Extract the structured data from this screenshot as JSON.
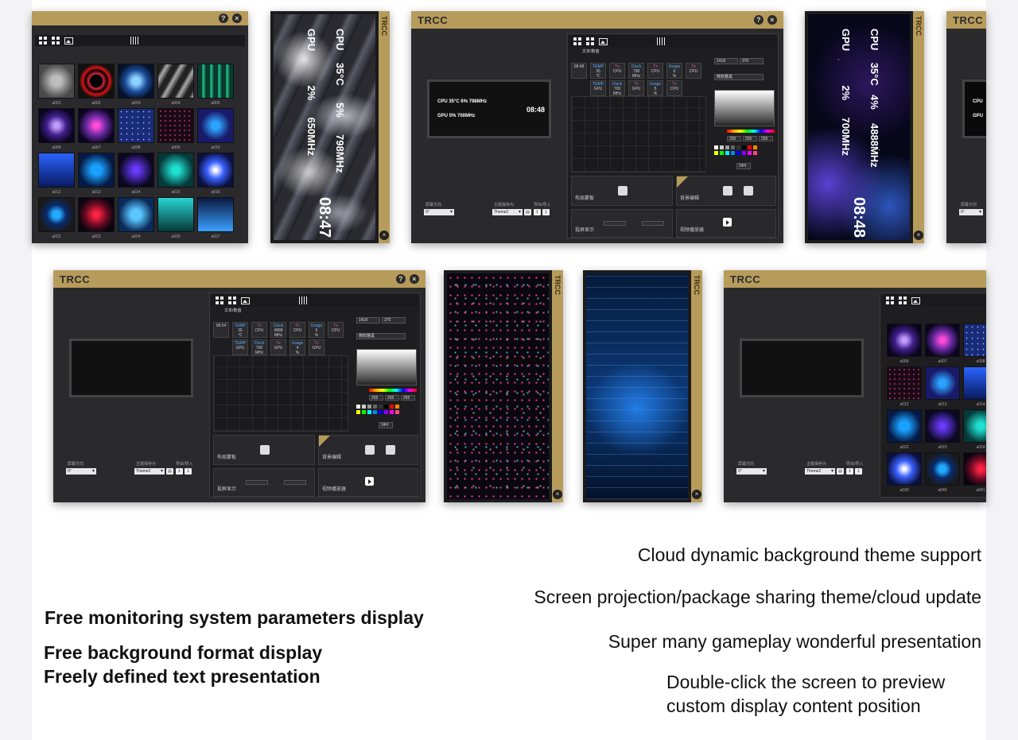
{
  "app": {
    "title": "TRCC",
    "help_icon": "question-icon",
    "close_icon": "close-icon"
  },
  "preview_silk": {
    "cpu_label": "CPU",
    "cpu_temp": "35°C",
    "cpu_usage": "5%",
    "cpu_clock": "798MHz",
    "gpu_label": "GPU",
    "gpu_usage": "2%",
    "gpu_clock": "650MHz",
    "time": "08:47"
  },
  "preview_space": {
    "cpu_label": "CPU",
    "cpu_temp": "35°C",
    "cpu_usage": "4%",
    "cpu_clock": "4888MHz",
    "gpu_label": "GPU",
    "gpu_usage": "2%",
    "gpu_clock": "700MHz",
    "time": "08:48"
  },
  "editor_preview": {
    "cpu_line": "CPU 35°C   6%   798MHz",
    "gpu_line": "GPU         5%   700MHz",
    "time": "08:48"
  },
  "editor": {
    "text_image_tab": "文本/数值",
    "cells_row1": [
      {
        "top": "TEMP",
        "mid": "35",
        "bot": "℃"
      },
      {
        "top": "Tx",
        "mid": "CPU",
        "bot": ""
      },
      {
        "top": "Clock",
        "mid": "798",
        "bot": "MHz"
      },
      {
        "top": "Tx",
        "mid": "CPU",
        "bot": ""
      },
      {
        "top": "Usage",
        "mid": "6",
        "bot": "%"
      },
      {
        "top": "Tx",
        "mid": "CPU",
        "bot": ""
      }
    ],
    "cells_row2": [
      {
        "top": "TEMP",
        "mid": "GPU",
        "bot": ""
      },
      {
        "top": "Clock",
        "mid": "700",
        "bot": "MHz"
      },
      {
        "top": "Tx",
        "mid": "GPU",
        "bot": ""
      },
      {
        "top": "Usage",
        "mid": "5",
        "bot": "%"
      },
      {
        "top": "Tx",
        "mid": "CPU",
        "bot": ""
      }
    ],
    "time_cell": "08:48",
    "coord_x": "1418",
    "coord_y": "370",
    "font_value": "微软雅黑",
    "font_size": "22",
    "rgb": [
      "255",
      "255",
      "255"
    ],
    "hour_format": "24H",
    "mask_label": "布局蒙板",
    "bg_edit_label": "背景编辑",
    "projection_label": "投屏显示",
    "video_player_label": "视频播放器",
    "import_label": "载入",
    "direction_label": "屏幕方向",
    "theme_save_label": "主题保存为",
    "export_label": "导出/导入",
    "theme_name": "Theme2",
    "direction_value": "0°"
  },
  "editor2": {
    "cells_row1": [
      {
        "top": "TEMP",
        "mid": "35",
        "bot": "℃"
      },
      {
        "top": "Tx",
        "mid": "CPU",
        "bot": ""
      },
      {
        "top": "Clock",
        "mid": "4888",
        "bot": "MHz"
      },
      {
        "top": "Tx",
        "mid": "CPU",
        "bot": ""
      },
      {
        "top": "Usage",
        "mid": "6",
        "bot": "%"
      },
      {
        "top": "Tx",
        "mid": "CPU",
        "bot": ""
      }
    ],
    "cells_row2": [
      {
        "top": "TEMP",
        "mid": "GPU",
        "bot": ""
      },
      {
        "top": "Clock",
        "mid": "700",
        "bot": "MHz"
      },
      {
        "top": "Tx",
        "mid": "GPU",
        "bot": ""
      },
      {
        "top": "Usage",
        "mid": "4",
        "bot": "%"
      },
      {
        "top": "Tx",
        "mid": "GPU",
        "bot": ""
      }
    ],
    "time_cell": "08:54"
  },
  "thumbs1": [
    "a001",
    "a002",
    "a003",
    "a004",
    "a005",
    "a006",
    "a007",
    "a008",
    "a009",
    "a010",
    "a012",
    "a013",
    "a014",
    "a015",
    "a016",
    "a022",
    "a023",
    "a024",
    "a026",
    "a027"
  ],
  "thumbs2": [
    "a006",
    "a007",
    "a008",
    "a012",
    "a013",
    "a014",
    "a022",
    "a023",
    "a024",
    "a030",
    "a040",
    "a041"
  ],
  "features_right": {
    "line1": "Cloud dynamic background theme support",
    "line2": "Screen projection/package sharing theme/cloud update",
    "line3": "Super many gameplay wonderful presentation",
    "line4a": "Double-click the screen to preview",
    "line4b": "custom display content position"
  },
  "features_left": {
    "line1": "Free monitoring system parameters display",
    "line2": "Free background format display",
    "line3": "Freely defined text presentation"
  }
}
